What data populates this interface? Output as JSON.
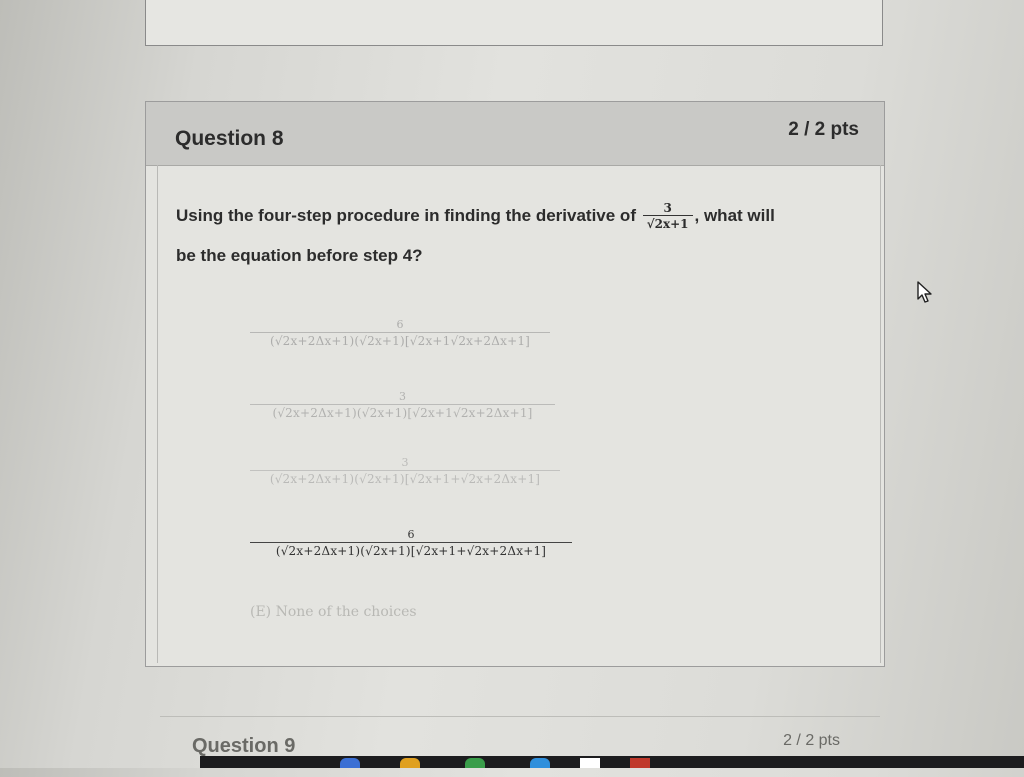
{
  "question": {
    "title": "Question 8",
    "points": "2 / 2 pts",
    "text_before": "Using the four-step procedure in finding the derivative of",
    "fraction_numerator": "3",
    "fraction_denominator": "√2x+1",
    "text_after": ", what will",
    "text_line2": "be the equation before step 4?"
  },
  "answers": [
    {
      "numerator": "6",
      "denominator": "(√2x+2Δx+1)(√2x+1)[√2x+1√2x+2Δx+1]"
    },
    {
      "numerator": "3",
      "denominator": "(√2x+2Δx+1)(√2x+1)[√2x+1√2x+2Δx+1]"
    },
    {
      "numerator": "3",
      "denominator": "(√2x+2Δx+1)(√2x+1)[√2x+1+√2x+2Δx+1]"
    },
    {
      "numerator": "6",
      "denominator": "(√2x+2Δx+1)(√2x+1)[√2x+1+√2x+2Δx+1]"
    }
  ],
  "answer_e": "(E) None of the choices",
  "next_question": {
    "title": "Question 9",
    "points": "2 / 2 pts"
  },
  "colors": {
    "header_bg": "#c9c9c6",
    "card_bg": "#e4e4e0",
    "text": "#2c2c2c",
    "taskbar": "#1c1c1e"
  },
  "icons": [
    "mouse-cursor-icon"
  ]
}
